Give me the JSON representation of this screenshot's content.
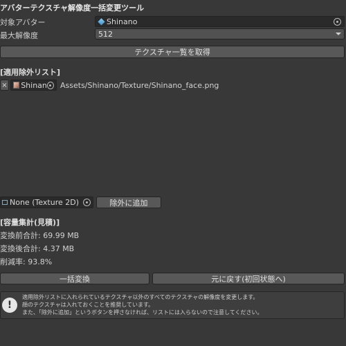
{
  "title": "アバターテクスチャ解像度一括変更ツール",
  "target_avatar": {
    "label": "対象アバター",
    "value": "Shinano",
    "icon": "prefab-cube-icon"
  },
  "max_resolution": {
    "label": "最大解像度",
    "value": "512"
  },
  "fetch_button": "テクスチャ一覧を取得",
  "exclusion_list": {
    "header": "[適用除外リスト]",
    "items": [
      {
        "remove": "×",
        "name": "Shinan",
        "path": "Assets/Shinano/Texture/Shinano_face.png",
        "icon": "texture-thumbnail-icon"
      }
    ]
  },
  "add_field": {
    "value": "None (Texture 2D)",
    "icon": "texture2d-icon"
  },
  "add_button": "除外に追加",
  "summary": {
    "header": "[容量集計(見積)]",
    "before": "変換前合計: 69.99 MB",
    "after": "変換後合計: 4.37 MB",
    "reduction": "削減率: 93.8%"
  },
  "convert_button": "一括変換",
  "revert_button": "元に戻す(初回状態へ)",
  "help": {
    "icon": "warning-icon",
    "lines": [
      "適用除外リストに入れられているテクスチャ以外のすべてのテクスチャの解像度を変更します。",
      "顔のテクスチャは入れておくことを推奨しています。",
      "また、「除外に追加」というボタンを押さなければ、リストには入らないので注意してください。"
    ]
  },
  "colors": {
    "background": "#383838",
    "field": "#2a2a2a",
    "button": "#585858",
    "text": "#d2d2d2"
  }
}
